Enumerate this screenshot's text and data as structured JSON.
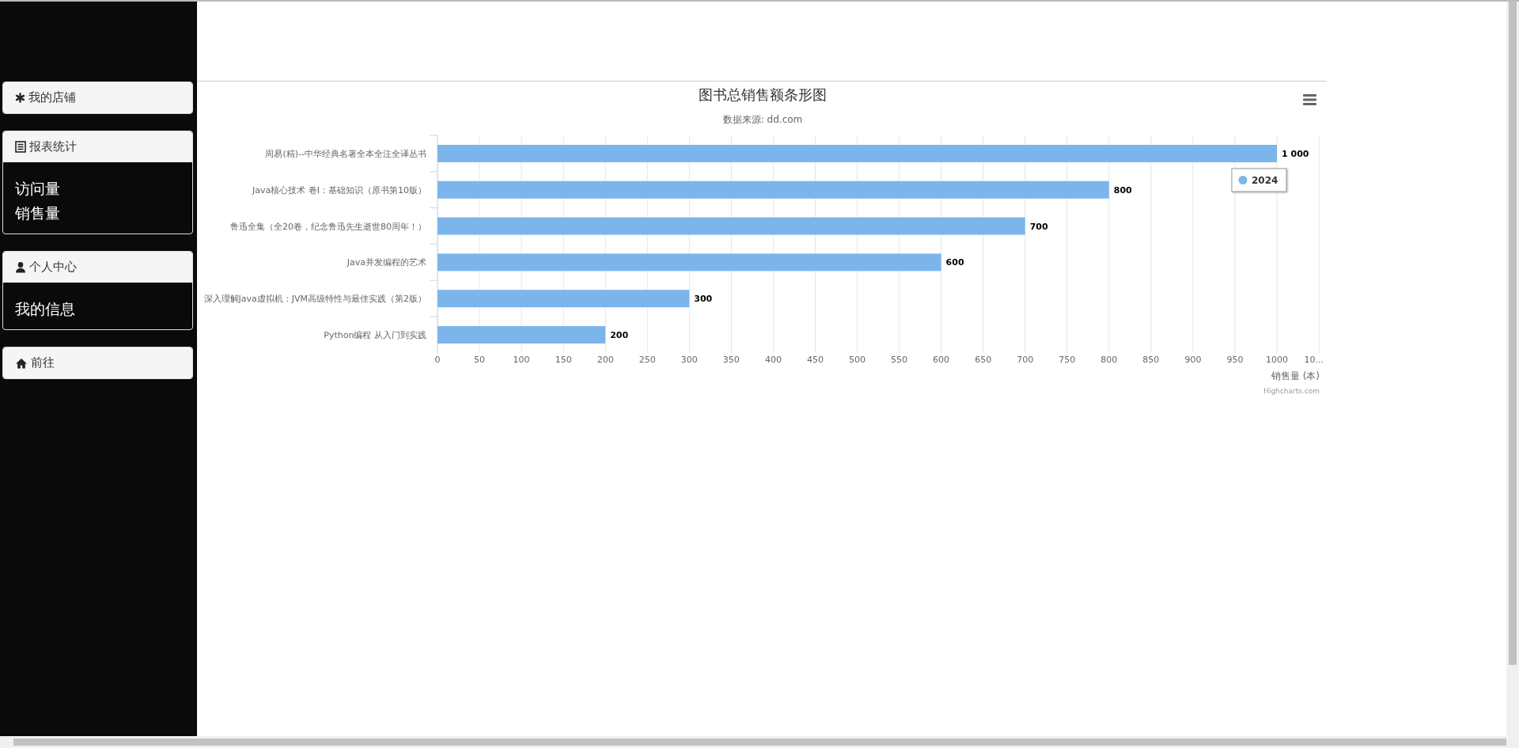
{
  "sidebar": {
    "panels": [
      {
        "title": "我的店铺"
      },
      {
        "title": "报表统计",
        "items": [
          "访问量",
          "销售量"
        ]
      },
      {
        "title": "个人中心",
        "items": [
          "我的信息"
        ]
      },
      {
        "title": "前往"
      }
    ]
  },
  "chart": {
    "credits": "Highcharts.com",
    "chart_data": {
      "type": "bar",
      "orientation": "horizontal",
      "grid": true,
      "title": "图书总销售额条形图",
      "subtitle": "数据来源: dd.com",
      "xlabel": "销售量 (本)",
      "categories": [
        "周易(精)--中华经典名著全本全注全译丛书",
        "Java核心技术 卷I：基础知识（原书第10版）",
        "鲁迅全集（全20卷，纪念鲁迅先生逝世80周年！）",
        "Java并发编程的艺术",
        "深入理解Java虚拟机：JVM高级特性与最佳实践（第2版）",
        "Python编程 从入门到实践"
      ],
      "series": [
        {
          "name": "2024",
          "color": "#7cb5ec",
          "values": [
            1000,
            800,
            700,
            600,
            300,
            200
          ]
        }
      ],
      "value_labels": [
        "1 000",
        "800",
        "700",
        "600",
        "300",
        "200"
      ],
      "xlim": [
        0,
        1050
      ],
      "xticks": [
        0,
        50,
        100,
        150,
        200,
        250,
        300,
        350,
        400,
        450,
        500,
        550,
        600,
        650,
        700,
        750,
        800,
        850,
        900,
        950,
        1000,
        {
          "value": 1050,
          "label": "10..."
        }
      ]
    }
  }
}
